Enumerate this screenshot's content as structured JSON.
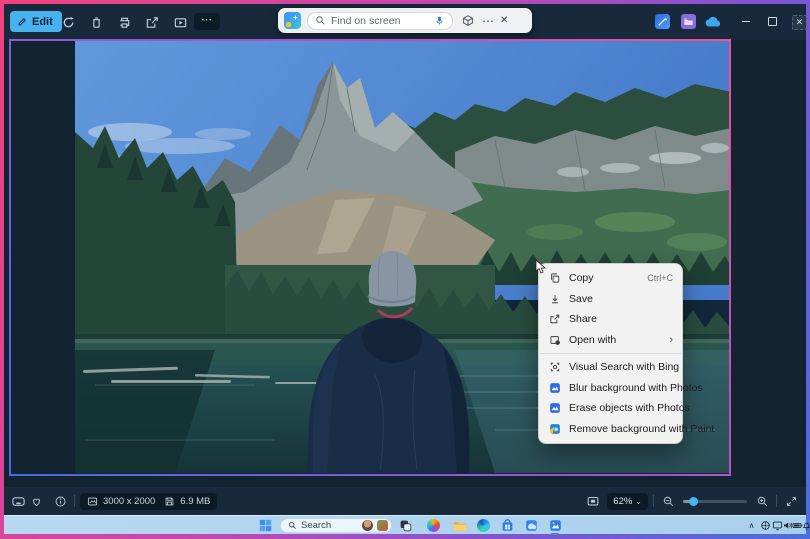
{
  "app": {
    "name": "Photos"
  },
  "glyphs": {
    "more": "⋯",
    "minimize": "—",
    "close": "✕",
    "submenu_arrow": "›",
    "chevron_down": "⌄",
    "chevron_up": "∧"
  },
  "toolbar": {
    "edit_label": "Edit"
  },
  "find_bar": {
    "placeholder": "Find on screen"
  },
  "context_menu": {
    "groups": [
      {
        "items": [
          {
            "label": "Copy",
            "shortcut": "Ctrl+C",
            "icon": "copy-icon"
          },
          {
            "label": "Save",
            "icon": "save-icon"
          },
          {
            "label": "Share",
            "icon": "share-icon"
          },
          {
            "label": "Open with",
            "icon": "open-with-icon",
            "has_submenu": true
          }
        ]
      },
      {
        "items": [
          {
            "label": "Visual Search with Bing",
            "icon": "visual-search-icon"
          },
          {
            "label": "Blur background with Photos",
            "icon": "photos-icon"
          },
          {
            "label": "Erase objects with Photos",
            "icon": "photos-icon"
          },
          {
            "label": "Remove background with Paint",
            "icon": "paint-icon"
          }
        ]
      }
    ]
  },
  "status_bar": {
    "dimensions": "3000 x 2000",
    "file_size": "6.9 MB",
    "zoom_level": "62%"
  },
  "taskbar": {
    "search_placeholder": "Search"
  },
  "colors": {
    "accent_blue": "#48b2f0",
    "highlight_gradient": [
      "#4b6be0",
      "#f24f96"
    ],
    "menu_bg": "#f2f2f2",
    "titlebar_bg": "#17293b"
  }
}
